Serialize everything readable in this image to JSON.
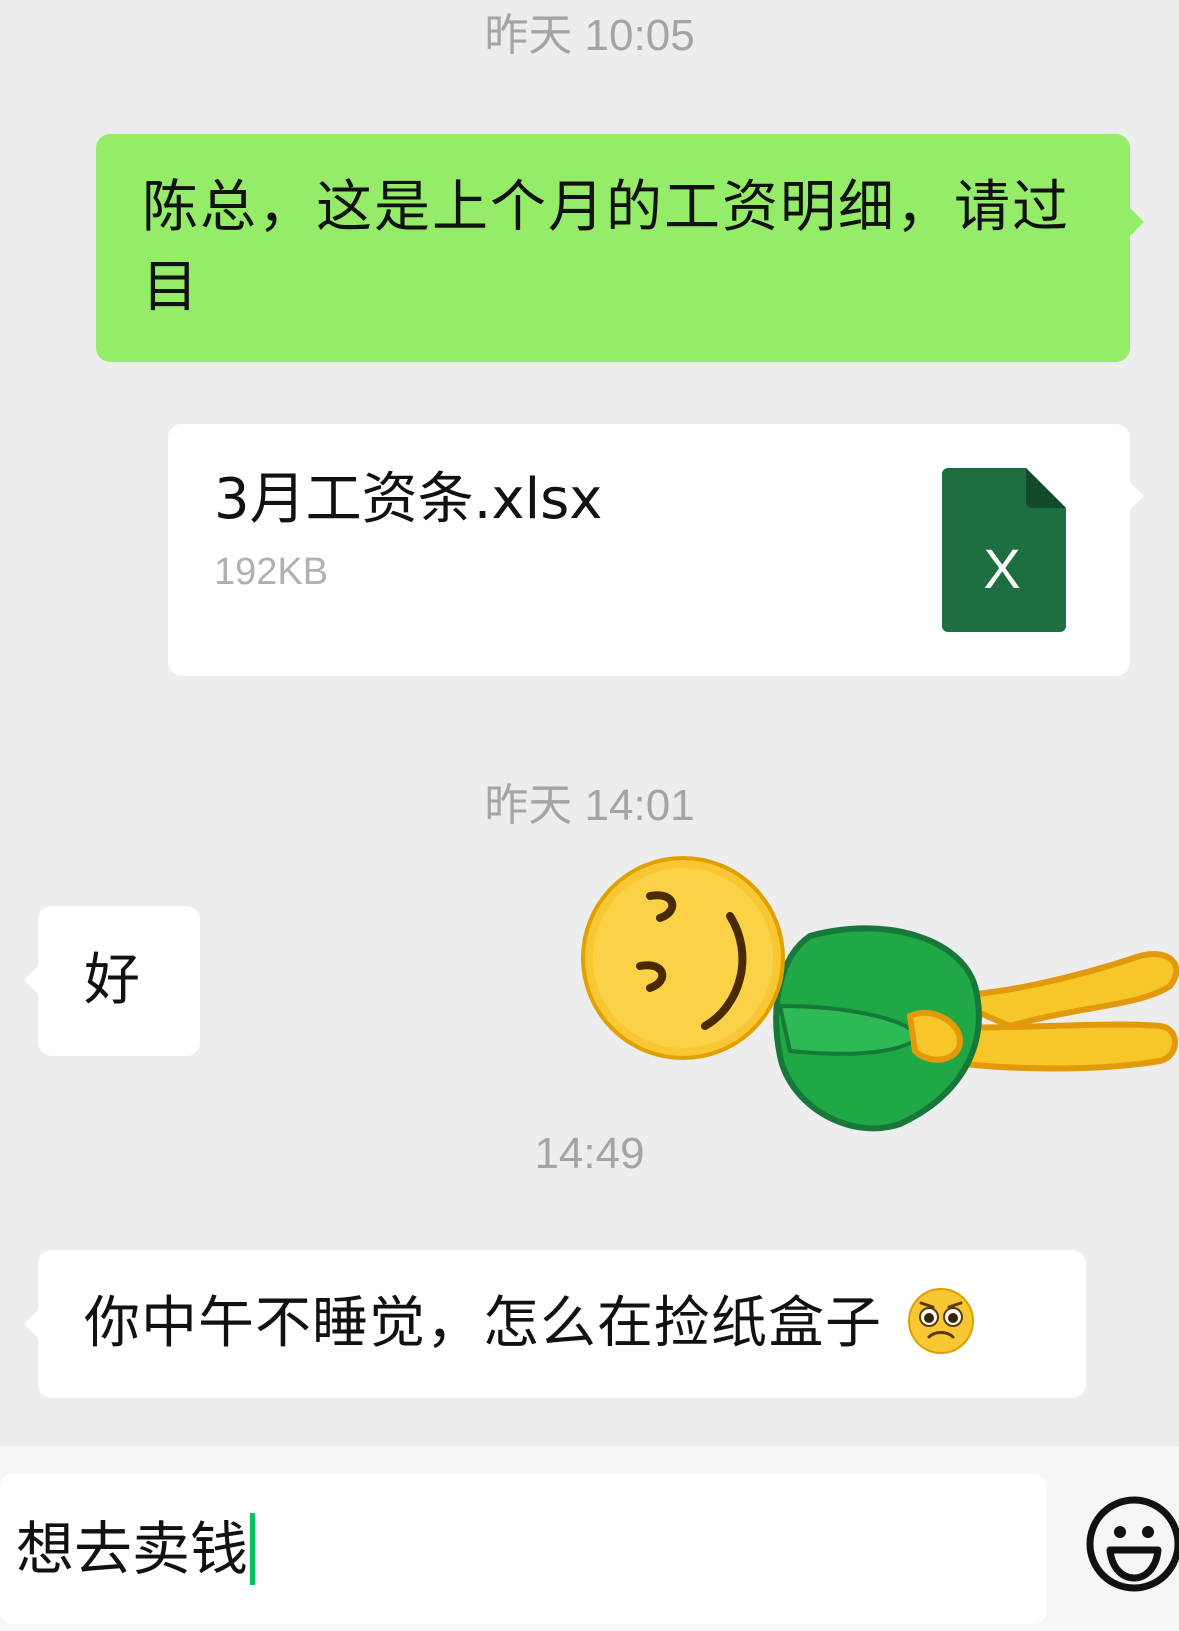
{
  "messages": {
    "ts1": "昨天 10:05",
    "out_text": "陈总，这是上个月的工资明细，请过目",
    "file": {
      "name": "3月工资条.xlsx",
      "size": "192KB",
      "icon_letter": "X"
    },
    "ts2": "昨天 14:01",
    "reply_ok": "好",
    "ts3": "14:49",
    "question": "你中午不睡觉，怎么在捡纸盒子"
  },
  "input": {
    "value": "想去卖钱"
  },
  "colors": {
    "background": "#ededed",
    "outgoing_bubble": "#95ec69",
    "incoming_bubble": "#ffffff",
    "timestamp": "#a4a4a4",
    "excel_green": "#1d6f42",
    "caret": "#07c160"
  },
  "icons": {
    "file_type": "excel-file-icon",
    "sticker": "lying-down-sticker",
    "inline_emoji": "pleading-face-emoji",
    "emoji_button": "smiley-face-icon"
  }
}
